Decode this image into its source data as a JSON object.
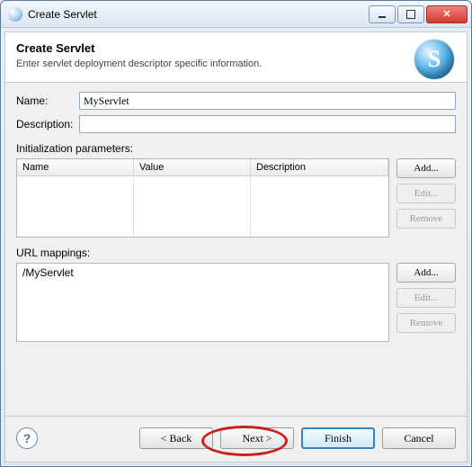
{
  "window": {
    "title": "Create Servlet"
  },
  "banner": {
    "heading": "Create Servlet",
    "subtext": "Enter servlet deployment descriptor specific information.",
    "badge_letter": "S"
  },
  "fields": {
    "name_label": "Name:",
    "name_value": "MyServlet",
    "desc_label": "Description:",
    "desc_value": ""
  },
  "init_params": {
    "section_label": "Initialization parameters:",
    "headers": {
      "name": "Name",
      "value": "Value",
      "desc": "Description"
    },
    "rows": [],
    "buttons": {
      "add": "Add...",
      "edit": "Edit...",
      "remove": "Remove"
    }
  },
  "url_mappings": {
    "section_label": "URL mappings:",
    "items": [
      "/MyServlet"
    ],
    "buttons": {
      "add": "Add...",
      "edit": "Edit...",
      "remove": "Remove"
    }
  },
  "footer": {
    "help_glyph": "?",
    "back": "< Back",
    "next": "Next >",
    "finish": "Finish",
    "cancel": "Cancel"
  }
}
